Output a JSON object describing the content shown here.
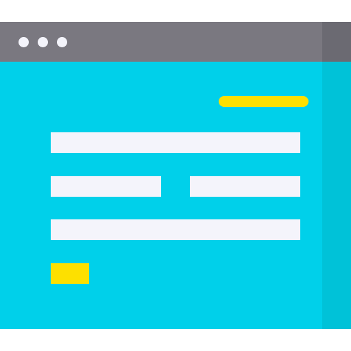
{
  "window": {
    "title_bar": {
      "controls": [
        "window-dot-icon",
        "window-dot-icon",
        "window-dot-icon"
      ]
    },
    "form": {
      "fields": [
        "text-field",
        "text-field",
        "text-field",
        "text-field"
      ],
      "submit_button": ""
    }
  },
  "colors": {
    "title_bar": "#7a7880",
    "title_bar_shade": "#6b6a72",
    "content": "#00d0ea",
    "content_shade": "#00c2d8",
    "field": "#f4f4fb",
    "accent": "#fde000"
  }
}
